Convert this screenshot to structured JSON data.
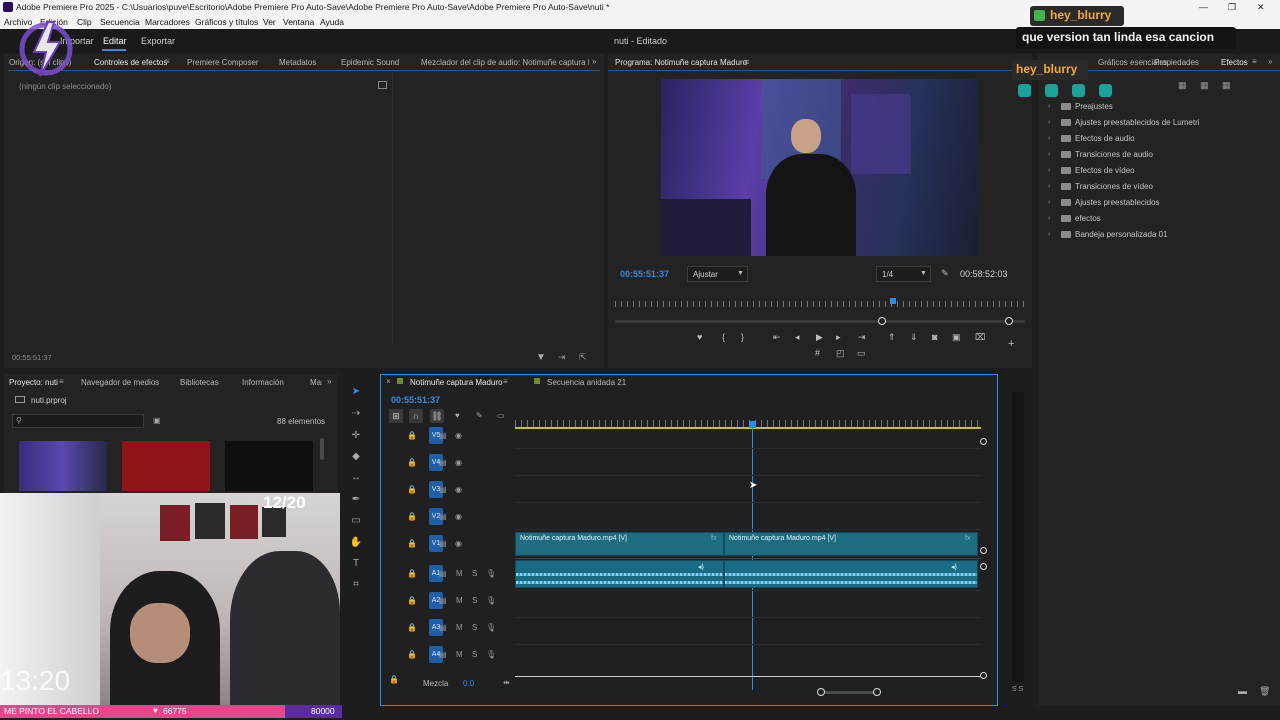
{
  "window": {
    "title": "Adobe Premiere Pro 2025 - C:\\Usuarios\\puve\\Escritorio\\Adobe Premiere Pro Auto-Save\\Adobe Premiere Pro Auto-Save\\Adobe Premiere Pro Auto-Save\\nuti *",
    "minimize": "—",
    "maximize": "❐",
    "close": "✕"
  },
  "menu": [
    "Archivo",
    "Edición",
    "Clip",
    "Secuencia",
    "Marcadores",
    "Gráficos y títulos",
    "Ver",
    "Ventana",
    "Ayuda"
  ],
  "workspace": {
    "tabs": [
      "Importar",
      "Editar",
      "Exportar"
    ],
    "project_status": "nuti - Editado"
  },
  "source_panel": {
    "tabs": [
      "Origen: (sin clips)",
      "Controles de efectos",
      "Premiere Composer",
      "Metadatos",
      "Epidemic Sound",
      "Mezclador del clip de audio: Notimuñe captura Maduro"
    ],
    "empty_text": "(ningún clip seleccionado)",
    "timecode": "00:55:51:37"
  },
  "program_monitor": {
    "title": "Programa: Notimuñe captura Maduro",
    "timecode_current": "00:55:51:37",
    "fit": "Ajustar",
    "resolution": "1/4",
    "timecode_duration": "00:58:52:03"
  },
  "effects_panel": {
    "tabs": [
      "Gráficos esenciales",
      "Propiedades",
      "Efectos"
    ],
    "items": [
      "Preajustes",
      "Ajustes preestablecidos de Lumetri",
      "Efectos de audio",
      "Transiciones de audio",
      "Efectos de vídeo",
      "Transiciones de vídeo",
      "Ajustes preestablecidos",
      "efectos",
      "Bandeja personalizada 01"
    ]
  },
  "project_panel": {
    "tabs": [
      "Proyecto: nuti",
      "Navegador de medios",
      "Bibliotecas",
      "Información",
      "Marcadores"
    ],
    "file": "nuti.prproj",
    "count": "88 elementos"
  },
  "timeline": {
    "tabs": [
      "Notimuñe captura Maduro",
      "Secuencia anidada 21"
    ],
    "timecode": "00:55:51:37",
    "video_tracks": [
      "V5",
      "V4",
      "V3",
      "V2",
      "V1"
    ],
    "audio_tracks": [
      "A1",
      "A2",
      "A3",
      "A4"
    ],
    "clip_label_1": "Notimuñe captura Maduro.mp4 [V]",
    "clip_label_2": "Notimuñe captura Maduro.mp4 [V]",
    "mix_label": "Mezcla",
    "mix_value": "0.0",
    "m_label": "M",
    "s_label": "S"
  },
  "meter": {
    "labels": "S S"
  },
  "stream_overlay": {
    "chat_user": "hey_blurry",
    "chat_message": "que version tan linda esa cancion",
    "chat_user_2": "hey_blurry",
    "counter": "12/20",
    "clock": "13:20",
    "goal_text": "ME PINTO EL CABELLO",
    "goal_current": "66775",
    "goal_target": "80000"
  },
  "colors": {
    "accent_blue": "#2d8ceb",
    "clip_teal": "#1d6c7f",
    "goal_pink": "#e8468a"
  }
}
